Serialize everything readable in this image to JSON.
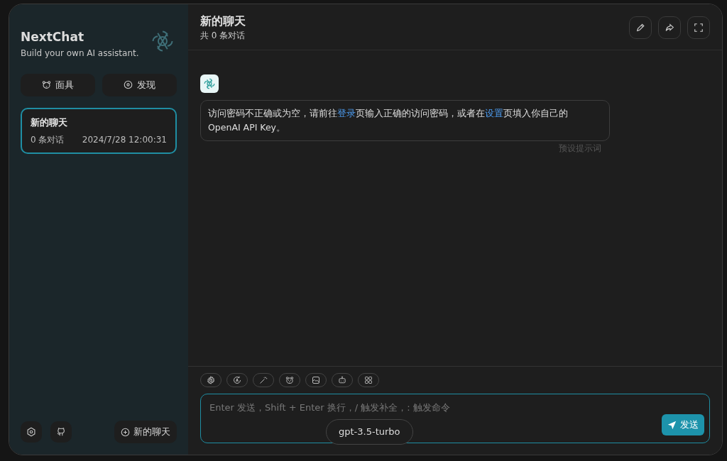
{
  "sidebar": {
    "title": "NextChat",
    "subtitle": "Build your own AI assistant.",
    "buttons": [
      {
        "kind": "mask",
        "label": "面具"
      },
      {
        "kind": "discover",
        "label": "发现"
      }
    ],
    "chats": [
      {
        "title": "新的聊天",
        "count": "0 条对话",
        "time": "2024/7/28 12:00:31",
        "selected": true
      }
    ],
    "new_chat": "新的聊天"
  },
  "header": {
    "title": "新的聊天",
    "subtitle": "共 0 条对话"
  },
  "message": {
    "parts": [
      {
        "kind": "text",
        "text": "访问密码不正确或为空，请前往"
      },
      {
        "kind": "link",
        "text": "登录"
      },
      {
        "kind": "text",
        "text": "页输入正确的访问密码，或者在"
      },
      {
        "kind": "link",
        "text": "设置"
      },
      {
        "kind": "text",
        "text": "页填入你自己的 OpenAI API Key。"
      }
    ],
    "footer": "预设提示词"
  },
  "input": {
    "placeholder": "Enter 发送，Shift + Enter 换行，/ 触发补全，: 触发命令",
    "model": "gpt-3.5-turbo",
    "send": "发送"
  }
}
